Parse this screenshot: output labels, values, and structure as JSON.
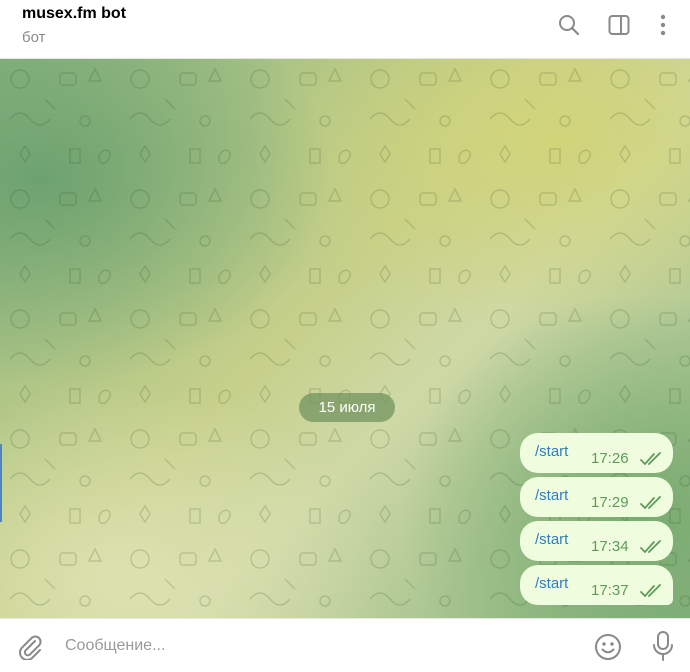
{
  "header": {
    "title": "musex.fm bot",
    "subtitle": "бот",
    "icons": [
      "search-icon",
      "sidebar-toggle-icon",
      "more-vertical-icon"
    ]
  },
  "chat": {
    "date_label": "15 июля",
    "messages": [
      {
        "text": "/start",
        "time": "17:26",
        "status": "read"
      },
      {
        "text": "/start",
        "time": "17:29",
        "status": "read"
      },
      {
        "text": "/start",
        "time": "17:34",
        "status": "read"
      },
      {
        "text": "/start",
        "time": "17:37",
        "status": "read"
      }
    ]
  },
  "composer": {
    "placeholder": "Сообщение...",
    "value": "",
    "icons": [
      "paperclip-icon",
      "emoji-icon",
      "microphone-icon"
    ]
  },
  "colors": {
    "accent": "#2f7ebf",
    "outgoing_bubble": "#effdde",
    "time_text": "#5e9a5b",
    "icon_gray": "#8a8a8a"
  }
}
